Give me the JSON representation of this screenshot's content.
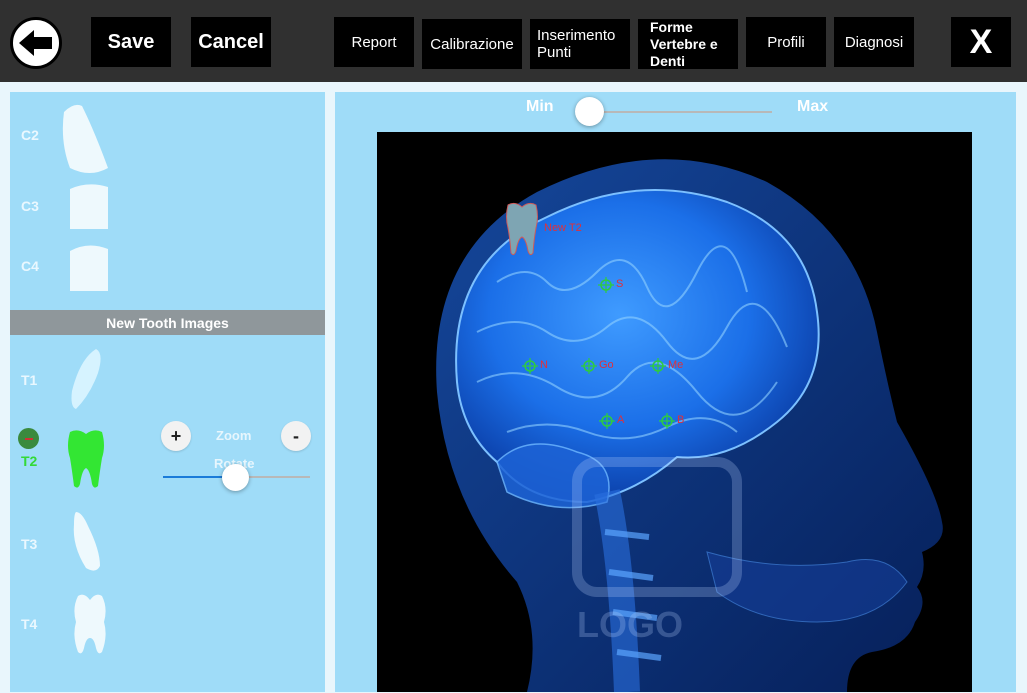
{
  "toolbar": {
    "back_icon": "arrow-left-icon",
    "save_label": "Save",
    "cancel_label": "Cancel",
    "report_label": "Report",
    "calibration_label": "Calibrazione",
    "points_label": "Inserimento\nPunti",
    "shapes_label": "Forme\nVertebre e\nDenti",
    "profiles_label": "Profili",
    "diagnosis_label": "Diagnosi",
    "close_label": "X"
  },
  "sidebar": {
    "vertebrae": [
      {
        "label": "C2",
        "icon": "vertebra-c2-icon"
      },
      {
        "label": "C3",
        "icon": "vertebra-c3-icon"
      },
      {
        "label": "C4",
        "icon": "vertebra-c4-icon"
      }
    ],
    "section_title": "New Tooth Images",
    "teeth": [
      {
        "label": "T1",
        "icon": "tooth-t1-icon"
      },
      {
        "label": "T2",
        "icon": "tooth-t2-icon",
        "selected": true
      },
      {
        "label": "T3",
        "icon": "tooth-t3-icon"
      },
      {
        "label": "T4",
        "icon": "tooth-t4-icon"
      }
    ],
    "zoom_in_label": "+",
    "zoom_label": "Zoom",
    "zoom_out_label": "-",
    "rotate_label": "Rotate",
    "rotate_value": 0.5
  },
  "viewer": {
    "min_label": "Min",
    "max_label": "Max",
    "brightness_value": 0.0,
    "overlay_label": "New T2",
    "landmarks": [
      "S",
      "N",
      "Go",
      "Me",
      "A",
      "B"
    ],
    "watermark": "LOGO"
  },
  "colors": {
    "toolbar_bg": "#303030",
    "panel_bg": "#9fdcf8",
    "selected_tooth": "#33d936",
    "landmark": "#2ecc40",
    "landmark_label": "#e0303a"
  }
}
